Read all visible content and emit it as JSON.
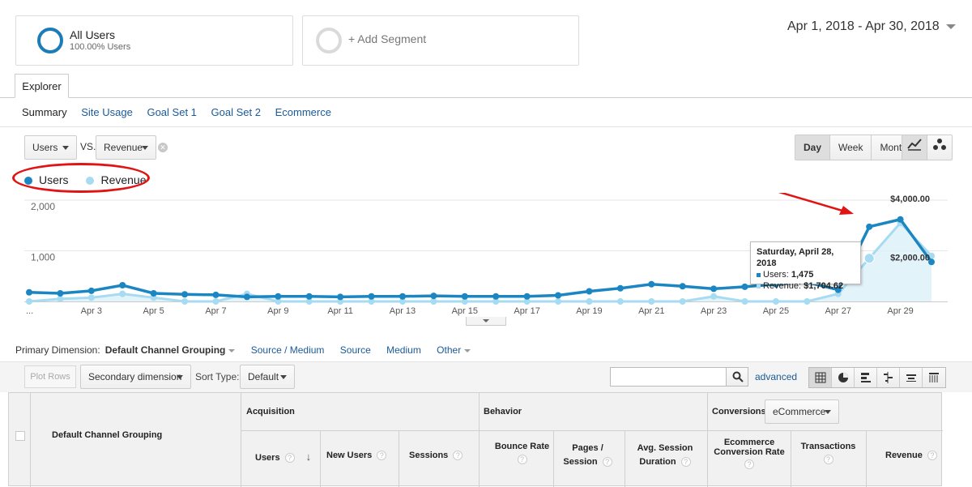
{
  "segments": {
    "all_users": {
      "title": "All Users",
      "subtitle": "100.00% Users"
    },
    "add_segment": "+ Add Segment"
  },
  "date_range": "Apr 1, 2018 - Apr 30, 2018",
  "tabs": {
    "explorer": "Explorer"
  },
  "subnav": [
    "Summary",
    "Site Usage",
    "Goal Set 1",
    "Goal Set 2",
    "Ecommerce"
  ],
  "metric_select": {
    "primary": "Users",
    "vs": "VS.",
    "secondary": "Revenue"
  },
  "granularity": {
    "day": "Day",
    "week": "Week",
    "month": "Month"
  },
  "legend": {
    "users": "Users",
    "revenue": "Revenue"
  },
  "colors": {
    "users": "#1b86c1",
    "revenue": "#a6dbf1",
    "annotation": "#e01414",
    "link": "#1a5a98"
  },
  "icons": [
    "line-chart-icon",
    "motion-chart-icon",
    "search-icon",
    "grid-view-icon",
    "pie-view-icon",
    "bar-view-icon",
    "comparison-view-icon",
    "term-cloud-icon",
    "pivot-view-icon"
  ],
  "chart_data": {
    "type": "line",
    "x": [
      "Apr 1",
      "Apr 2",
      "Apr 3",
      "Apr 4",
      "Apr 5",
      "Apr 6",
      "Apr 7",
      "Apr 8",
      "Apr 9",
      "Apr 10",
      "Apr 11",
      "Apr 12",
      "Apr 13",
      "Apr 14",
      "Apr 15",
      "Apr 16",
      "Apr 17",
      "Apr 18",
      "Apr 19",
      "Apr 20",
      "Apr 21",
      "Apr 22",
      "Apr 23",
      "Apr 24",
      "Apr 25",
      "Apr 26",
      "Apr 27",
      "Apr 28",
      "Apr 29",
      "Apr 30"
    ],
    "x_tick_labels": [
      "...",
      "Apr 3",
      "Apr 5",
      "Apr 7",
      "Apr 9",
      "Apr 11",
      "Apr 13",
      "Apr 15",
      "Apr 17",
      "Apr 19",
      "Apr 21",
      "Apr 23",
      "Apr 25",
      "Apr 27",
      "Apr 29"
    ],
    "y_left_ticks": [
      "2,000",
      "1,000"
    ],
    "y_left_range": [
      0,
      2000
    ],
    "y_right_labels": [
      "$4,000.00",
      "$2,000.00"
    ],
    "y_right_range": [
      0,
      4000
    ],
    "grid": true,
    "series": [
      {
        "name": "Users",
        "axis": "left",
        "values": [
          180,
          160,
          210,
          320,
          160,
          140,
          130,
          90,
          100,
          100,
          90,
          100,
          100,
          110,
          100,
          100,
          100,
          120,
          200,
          260,
          340,
          300,
          250,
          290,
          340,
          380,
          230,
          1475,
          1620,
          780
        ]
      },
      {
        "name": "Revenue",
        "axis": "right",
        "values": [
          0,
          100,
          150,
          300,
          150,
          0,
          0,
          300,
          0,
          0,
          0,
          0,
          0,
          0,
          0,
          0,
          0,
          0,
          0,
          0,
          0,
          0,
          200,
          0,
          0,
          0,
          300,
          1704.62,
          3100,
          1800
        ]
      }
    ],
    "tooltip": {
      "date": "Saturday, April 28, 2018",
      "users_label": "Users:",
      "users_value": "1,475",
      "revenue_label": "Revenue:",
      "revenue_value": "$1,704.62"
    }
  },
  "primary_dimension": {
    "label": "Primary Dimension:",
    "selected": "Default Channel Grouping",
    "options": [
      "Source / Medium",
      "Source",
      "Medium",
      "Other"
    ]
  },
  "table_toolbar": {
    "plot_rows": "Plot Rows",
    "secondary_dimension": "Secondary dimension",
    "sort_type_label": "Sort Type:",
    "sort_type": "Default",
    "advanced": "advanced"
  },
  "table": {
    "first_column": "Default Channel Grouping",
    "groups": {
      "acquisition": "Acquisition",
      "behavior": "Behavior",
      "conversions": "Conversions"
    },
    "conversions_select": "eCommerce",
    "columns": {
      "users": "Users",
      "new_users": "New Users",
      "sessions": "Sessions",
      "bounce_rate": "Bounce Rate",
      "pages_session_1": "Pages /",
      "pages_session_2": "Session",
      "avg_session_1": "Avg. Session",
      "avg_session_2": "Duration",
      "ecom_rate_1": "Ecommerce",
      "ecom_rate_2": "Conversion Rate",
      "transactions": "Transactions",
      "revenue": "Revenue"
    }
  }
}
